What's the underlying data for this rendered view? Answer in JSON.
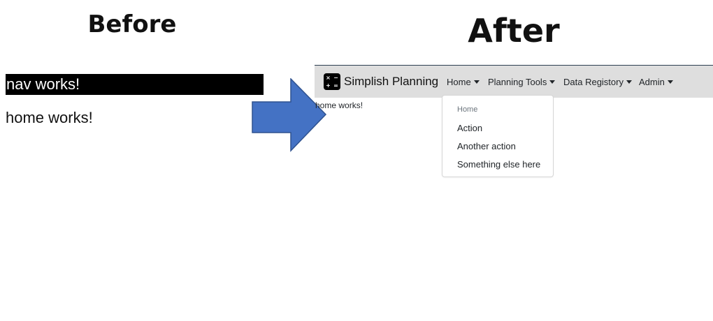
{
  "before": {
    "title": "Before",
    "nav_text": "nav works!",
    "home_text": "home works!"
  },
  "after": {
    "title": "After",
    "navbar": {
      "brand_text": "Simplish Planning",
      "brand_icon": "calculator-icon",
      "brand_icon_glyphs": [
        "×",
        "−",
        "+",
        "="
      ],
      "items": [
        {
          "label": "Home"
        },
        {
          "label": "Planning Tools"
        },
        {
          "label": "Data Registory"
        },
        {
          "label": "Admin"
        }
      ]
    },
    "home_text": "home works!",
    "dropdown": {
      "header": "Home",
      "items": [
        {
          "label": "Action"
        },
        {
          "label": "Another action"
        },
        {
          "label": "Something else here"
        }
      ]
    }
  },
  "colors": {
    "arrow_fill": "#4472c4",
    "arrow_stroke": "#2f528f",
    "navbar_bg": "#dedede",
    "before_nav_bg": "#000000"
  }
}
